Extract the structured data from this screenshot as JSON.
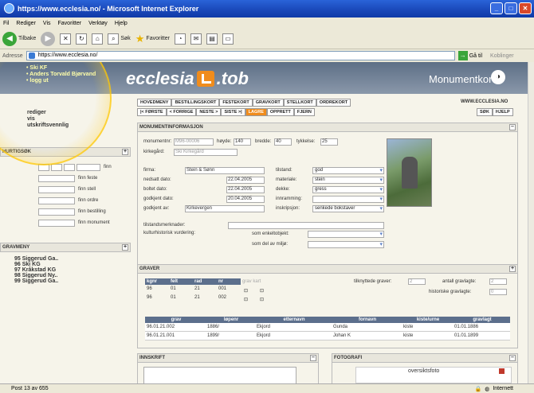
{
  "window": {
    "title": "https://www.ecclesia.no/ - Microsoft Internet Explorer",
    "btn_min": "_",
    "btn_max": "□",
    "btn_close": "✕"
  },
  "menu": [
    "Fil",
    "Rediger",
    "Vis",
    "Favoritter",
    "Verktøy",
    "Hjelp"
  ],
  "toolbar": {
    "back": "Tilbake",
    "back_glyph": "◀",
    "fwd_glyph": "▶",
    "stop": "✕",
    "refresh": "↻",
    "home": "⌂",
    "search": "Søk",
    "favorites": "Favoritter",
    "star": "★"
  },
  "address": {
    "label": "Adresse",
    "value": "https://www.ecclesia.no/",
    "go": "Gå til",
    "go_glyph": "→",
    "links": "Koblinger"
  },
  "header": {
    "user_lines": [
      "• Ski KF",
      "• Anders Torvald Bjørvand",
      "• logg ut"
    ],
    "logo_left": "ecclesia",
    "logo_right": ".tob",
    "page_title": "Monumentkort",
    "title_icon": "◑"
  },
  "leftlinks": [
    "rediger",
    "vis",
    "utskriftsvennlig"
  ],
  "hurtigsok": {
    "title": "HURTIGSØK",
    "toggle": "+",
    "items": [
      "finn",
      "finn feste",
      "finn stell",
      "finn ordre",
      "finn bestilling",
      "finn monument"
    ]
  },
  "gravmeny": {
    "title": "GRAVMENY",
    "toggle": "+",
    "items": [
      "95 Siggerud Ga..",
      "96 Ski KG",
      "97 Kråkstad KG",
      "98 Siggerud Ny..",
      "99 Siggerud Ga.."
    ]
  },
  "nav": [
    "HOVEDMENY",
    "BESTILLINGSKORT",
    "FESTEKORT",
    "GRAVKORT",
    "STELLKORT",
    "ORDREKORT"
  ],
  "site_url": "WWW.ECCLESIA.NO",
  "toolnav": [
    "|< FØRSTE",
    "< FORRIGE",
    "NESTE >",
    "SISTE >|",
    "LAGRE",
    "OPPRETT",
    "FJERN"
  ],
  "toolnav_active": "LAGRE",
  "searchnav": [
    "SØK",
    "HJELP"
  ],
  "monument": {
    "section_title": "MONUMENTINFORMASJON",
    "toggle": "–",
    "monumentnr_label": "monumentnr:",
    "monumentnr": "M96-00006",
    "hoyde_label": "høyde:",
    "hoyde": "140",
    "bredde_label": "bredde:",
    "bredde": "40",
    "tykkelse_label": "tykkelse:",
    "tykkelse": "25",
    "kirkegard_label": "kirkegård:",
    "kirkegard": "Ski Kirkegård",
    "firma_label": "firma:",
    "firma": "Stein & Sønn",
    "nedsatt_label": "nedsatt dato:",
    "nedsatt": "22.04.2005",
    "boltet_label": "boltet dato:",
    "boltet": "22.04.2005",
    "godkjent_dato_label": "godkjent dato:",
    "godkjent_dato": "20.04.2005",
    "godkjent_av_label": "godkjent av:",
    "godkjent_av": "Kirkevergen",
    "tilstand_label": "tilstand:",
    "tilstand": "god",
    "materiale_label": "materiale:",
    "materiale": "stein",
    "dekke_label": "dekke:",
    "dekke": "gress",
    "innramming_label": "innramming:",
    "innramming": "",
    "inskripsjon_label": "inskripsjon:",
    "inskripsjon": "senkede bokstaver",
    "tilstandsmerknader_label": "tilstandsmerknader:",
    "kulturhistorisk_label": "kulturhistorisk vurdering:",
    "enkeltobjekt_label": "som enkeltobjekt:",
    "miljo_label": "som del av miljø:"
  },
  "graver": {
    "title": "GRAVER",
    "toggle": "+",
    "cols": [
      "kgnr",
      "felt",
      "rad",
      "nr"
    ],
    "kart_label": "grav kart",
    "btn_glyph": "⊡",
    "rows": [
      [
        "96",
        "01",
        "21",
        "001"
      ],
      [
        "96",
        "01",
        "21",
        "002"
      ]
    ],
    "tilknyttede_label": "tilknyttede graver:",
    "tilknyttede": "2",
    "antall_label": "antall gravlagte:",
    "antall": "2",
    "historiske_label": "historiske gravlagte:",
    "historiske": "0",
    "burial_cols": [
      "grav",
      "løpenr",
      "etternavn",
      "fornavn",
      "kiste/urne",
      "gravlagt"
    ],
    "burials": [
      [
        "96.01.21.002",
        "1886/",
        "Ekjord",
        "Gunda",
        "kiste",
        "01.01.1886"
      ],
      [
        "96.01.21.001",
        "1899/",
        "Ekjord",
        "Johan K",
        "kiste",
        "01.01.1899"
      ]
    ]
  },
  "innskrift": {
    "title": "INNSKRIFT",
    "toggle": "–"
  },
  "fotografi": {
    "title": "FOTOGRAFI",
    "toggle": "–",
    "caption": "oversiktsfoto"
  },
  "status": {
    "text": "Post 13 av 655",
    "zone": "Internett"
  }
}
